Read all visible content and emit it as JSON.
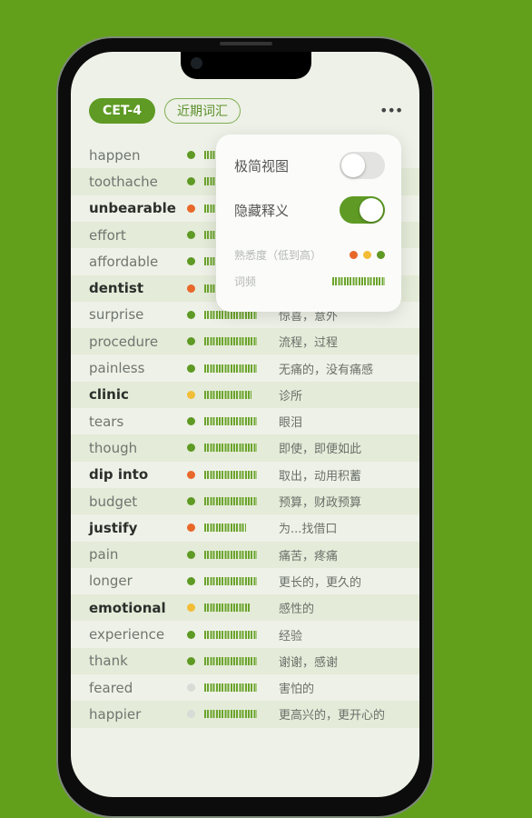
{
  "colors": {
    "background": "#62a01c",
    "accent": "#5e9a24",
    "low": "#e8682a",
    "mid": "#f2bd36",
    "high": "#5e9a24",
    "unknown": "#d8dbd6"
  },
  "header": {
    "tabs": [
      {
        "label": "CET-4",
        "active": true
      },
      {
        "label": "近期词汇",
        "active": false
      }
    ],
    "more_icon": "ellipsis-icon",
    "more_label": "•••"
  },
  "popup": {
    "minimal_view": {
      "label": "极简视图",
      "on": false
    },
    "hide_meaning": {
      "label": "隐藏释义",
      "on": true
    },
    "familiarity_label": "熟悉度（低到高）",
    "frequency_label": "词频"
  },
  "words": [
    {
      "word": "happen",
      "bold": false,
      "level": "high",
      "freq": 1,
      "meaning": ""
    },
    {
      "word": "toothache",
      "bold": false,
      "level": "high",
      "freq": 1,
      "meaning": ""
    },
    {
      "word": "unbearable",
      "bold": true,
      "level": "low",
      "freq": 1,
      "meaning": ""
    },
    {
      "word": "effort",
      "bold": false,
      "level": "high",
      "freq": 1,
      "meaning": ""
    },
    {
      "word": "affordable",
      "bold": false,
      "level": "high",
      "freq": 1,
      "meaning": ""
    },
    {
      "word": "dentist",
      "bold": true,
      "level": "low",
      "freq": 1,
      "meaning": ""
    },
    {
      "word": "surprise",
      "bold": false,
      "level": "high",
      "freq": 1,
      "meaning": "惊喜，意外"
    },
    {
      "word": "procedure",
      "bold": false,
      "level": "high",
      "freq": 1,
      "meaning": "流程，过程"
    },
    {
      "word": "painless",
      "bold": false,
      "level": "high",
      "freq": 1,
      "meaning": "无痛的，没有痛感"
    },
    {
      "word": "clinic",
      "bold": true,
      "level": "mid",
      "freq": 0.9,
      "meaning": "诊所"
    },
    {
      "word": "tears",
      "bold": false,
      "level": "high",
      "freq": 1,
      "meaning": "眼泪"
    },
    {
      "word": "though",
      "bold": false,
      "level": "high",
      "freq": 1,
      "meaning": "即使，即便如此"
    },
    {
      "word": "dip into",
      "bold": true,
      "level": "low",
      "freq": 1,
      "meaning": "取出，动用积蓄"
    },
    {
      "word": "budget",
      "bold": false,
      "level": "high",
      "freq": 1,
      "meaning": "预算，财政预算"
    },
    {
      "word": "justify",
      "bold": true,
      "level": "low",
      "freq": 0.8,
      "meaning": "为...找借口"
    },
    {
      "word": "pain",
      "bold": false,
      "level": "high",
      "freq": 1,
      "meaning": "痛苦，疼痛"
    },
    {
      "word": "longer",
      "bold": false,
      "level": "high",
      "freq": 1,
      "meaning": "更长的，更久的"
    },
    {
      "word": "emotional",
      "bold": true,
      "level": "mid",
      "freq": 0.86,
      "meaning": "感性的"
    },
    {
      "word": "experience",
      "bold": false,
      "level": "high",
      "freq": 1,
      "meaning": "经验"
    },
    {
      "word": "thank",
      "bold": false,
      "level": "high",
      "freq": 1,
      "meaning": "谢谢，感谢"
    },
    {
      "word": "feared",
      "bold": false,
      "level": "unknown",
      "freq": 1,
      "meaning": "害怕的"
    },
    {
      "word": "happier",
      "bold": false,
      "level": "unknown",
      "freq": 1,
      "meaning": "更高兴的，更开心的"
    }
  ]
}
